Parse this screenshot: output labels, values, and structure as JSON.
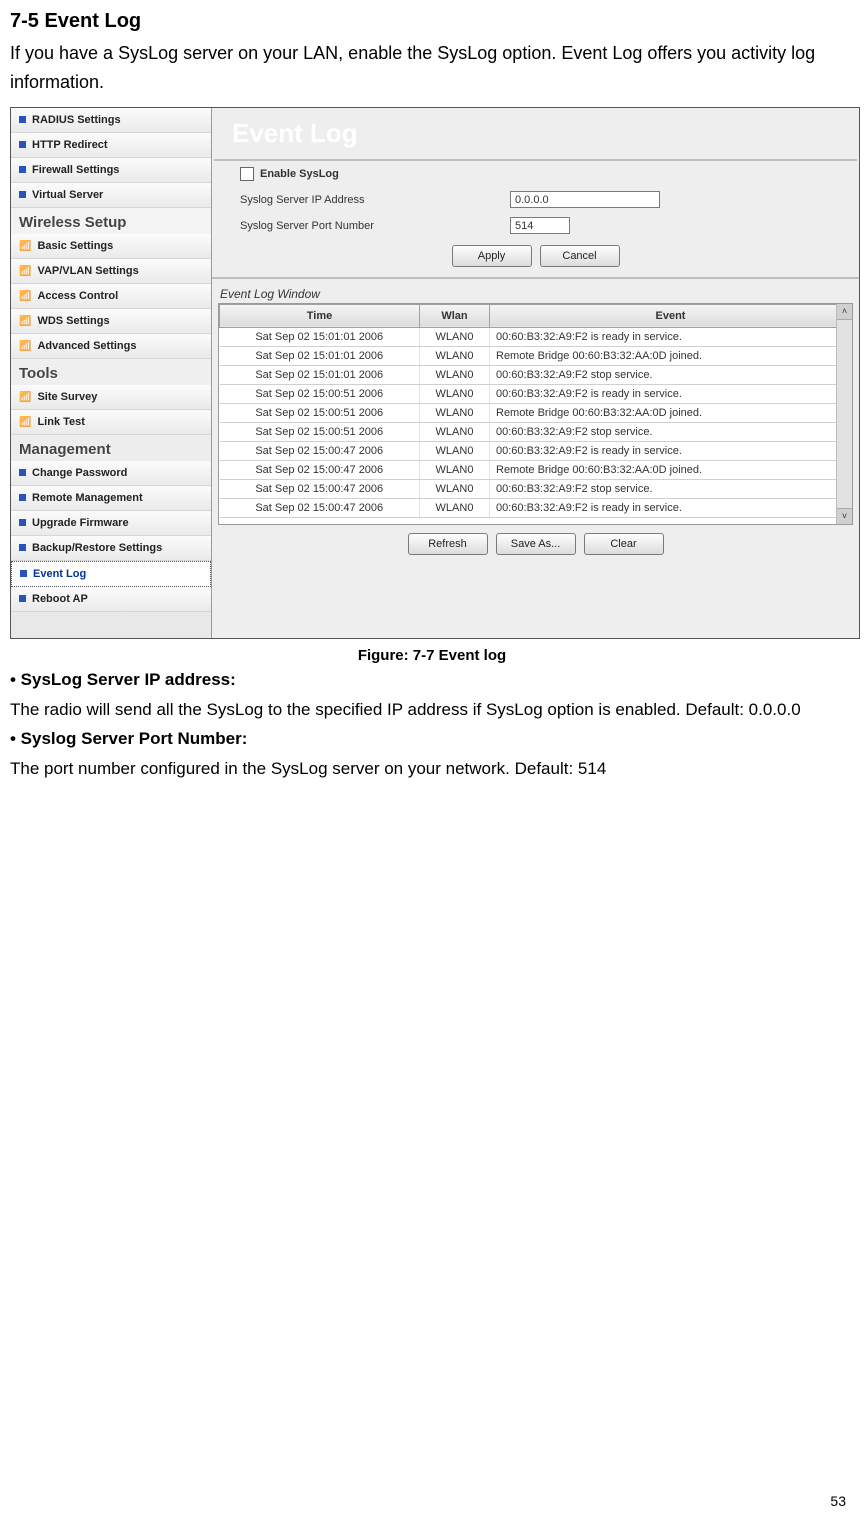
{
  "doc": {
    "section_title": "7-5    Event Log",
    "intro": "If you have a SysLog server on your LAN, enable the SysLog option. Event Log offers you activity log information.",
    "caption": "Figure: 7-7 Event log",
    "h_ip": "• SysLog Server IP address:",
    "p_ip": "The radio will send all the SysLog to the specified IP address if SysLog option is enabled. Default: 0.0.0.0",
    "h_port": "• Syslog Server Port Number:",
    "p_port": "The port number configured in the SysLog server on your network. Default: 514",
    "page_number": "53"
  },
  "nav": {
    "top_items": [
      "RADIUS Settings",
      "HTTP Redirect",
      "Firewall Settings",
      "Virtual Server"
    ],
    "group_wireless": "Wireless Setup",
    "wireless_items": [
      "Basic Settings",
      "VAP/VLAN Settings",
      "Access Control",
      "WDS Settings",
      "Advanced Settings"
    ],
    "group_tools": "Tools",
    "tools_items": [
      "Site Survey",
      "Link Test"
    ],
    "group_mgmt": "Management",
    "mgmt_items": [
      "Change Password",
      "Remote Management",
      "Upgrade Firmware",
      "Backup/Restore Settings",
      "Event Log",
      "Reboot AP"
    ],
    "selected": "Event Log"
  },
  "main": {
    "title": "Event Log",
    "enable_label": "Enable SysLog",
    "ip_label": "Syslog Server IP Address",
    "ip_value": "0.0.0.0",
    "port_label": "Syslog Server Port Number",
    "port_value": "514",
    "apply": "Apply",
    "cancel": "Cancel",
    "window_label": "Event Log Window",
    "col_time": "Time",
    "col_wlan": "Wlan",
    "col_event": "Event",
    "rows": [
      {
        "time": "Sat Sep 02 15:01:01 2006",
        "wlan": "WLAN0",
        "event": "00:60:B3:32:A9:F2 is ready in service."
      },
      {
        "time": "Sat Sep 02 15:01:01 2006",
        "wlan": "WLAN0",
        "event": "Remote Bridge 00:60:B3:32:AA:0D joined."
      },
      {
        "time": "Sat Sep 02 15:01:01 2006",
        "wlan": "WLAN0",
        "event": "00:60:B3:32:A9:F2 stop service."
      },
      {
        "time": "Sat Sep 02 15:00:51 2006",
        "wlan": "WLAN0",
        "event": "00:60:B3:32:A9:F2 is ready in service."
      },
      {
        "time": "Sat Sep 02 15:00:51 2006",
        "wlan": "WLAN0",
        "event": "Remote Bridge 00:60:B3:32:AA:0D joined."
      },
      {
        "time": "Sat Sep 02 15:00:51 2006",
        "wlan": "WLAN0",
        "event": "00:60:B3:32:A9:F2 stop service."
      },
      {
        "time": "Sat Sep 02 15:00:47 2006",
        "wlan": "WLAN0",
        "event": "00:60:B3:32:A9:F2 is ready in service."
      },
      {
        "time": "Sat Sep 02 15:00:47 2006",
        "wlan": "WLAN0",
        "event": "Remote Bridge 00:60:B3:32:AA:0D joined."
      },
      {
        "time": "Sat Sep 02 15:00:47 2006",
        "wlan": "WLAN0",
        "event": "00:60:B3:32:A9:F2 stop service."
      },
      {
        "time": "Sat Sep 02 15:00:47 2006",
        "wlan": "WLAN0",
        "event": "00:60:B3:32:A9:F2 is ready in service."
      }
    ],
    "refresh": "Refresh",
    "saveas": "Save As...",
    "clear": "Clear"
  }
}
